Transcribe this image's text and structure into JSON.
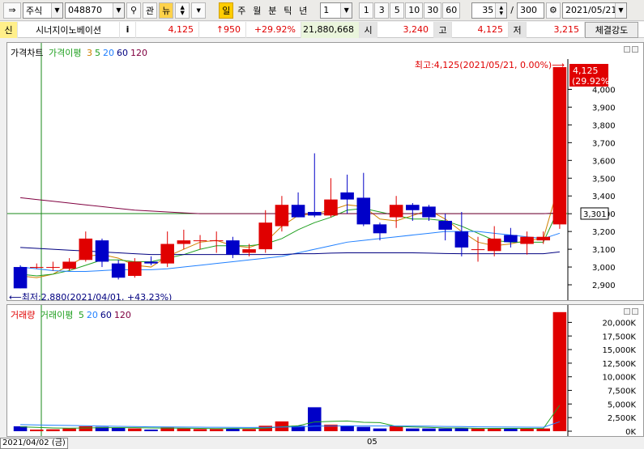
{
  "toolbar": {
    "market_select": "주식",
    "stock_code": "048870",
    "btn_gwan": "관",
    "btn_news": "뉴",
    "period_buttons": [
      "일",
      "주",
      "월",
      "분",
      "틱",
      "년"
    ],
    "unit_select": "1",
    "minute_buttons": [
      "1",
      "3",
      "5",
      "10",
      "30",
      "60"
    ],
    "display_count": "35",
    "slash": "/",
    "total_count": "300",
    "date": "2021/05/21"
  },
  "info": {
    "credit_badge": "신",
    "stock_name": "시너지이노베이션",
    "info_icon": "i",
    "price": "4,125",
    "change": "↑950",
    "change_rate": "+29.92%",
    "volume": "21,880,668",
    "open_label": "시",
    "open": "3,240",
    "high_label": "고",
    "high": "4,125",
    "low_label": "저",
    "low": "3,215",
    "strength_button": "체결강도"
  },
  "price_panel": {
    "legend_title": "가격차트",
    "legend_ma_label": "가격이평",
    "legend_ma_periods": [
      "3",
      "5",
      "20",
      "60",
      "120"
    ],
    "max_annotation": "최고:4,125(2021/05/21, 0.00%)⟶",
    "min_annotation": "⟵최저:2,880(2021/04/01, +43.23%)",
    "current_price_tag": "4,125",
    "current_rate_tag": "(29.92%)",
    "cursor_price_tag": "3,301",
    "y_ticks": [
      "4,000",
      "3,900",
      "3,800",
      "3,700",
      "3,600",
      "3,500",
      "3,400",
      "3,300",
      "3,200",
      "3,100",
      "3,000",
      "2,900"
    ]
  },
  "volume_panel": {
    "legend_title": "거래량",
    "legend_ma_label": "거래이평",
    "legend_ma_periods": [
      "5",
      "20",
      "60",
      "120"
    ],
    "y_ticks": [
      "20,000K",
      "17,500K",
      "15,000K",
      "12,500K",
      "10,000K",
      "7,500K",
      "5,000K",
      "2,500K",
      "0K"
    ]
  },
  "x_axis": {
    "cursor_date": "2021/04/02 (금)",
    "month_label": "05"
  },
  "colors": {
    "up": "#e00000",
    "down": "#0000c8",
    "ma3": "#d08000",
    "ma5": "#20a020",
    "ma20": "#2080ff",
    "ma60": "#000080",
    "ma120": "#800040",
    "crosshair": "#1a8a1a"
  },
  "chart_data": {
    "type": "candlestick",
    "ylim": [
      2850,
      4125
    ],
    "candles": [
      {
        "o": 3000,
        "c": 2880,
        "h": 3010,
        "l": 2880
      },
      {
        "o": 3000,
        "c": 3000,
        "h": 3020,
        "l": 2990
      },
      {
        "o": 3000,
        "c": 3000,
        "h": 3030,
        "l": 2980
      },
      {
        "o": 2990,
        "c": 3030,
        "h": 3050,
        "l": 2980
      },
      {
        "o": 3040,
        "c": 3160,
        "h": 3200,
        "l": 3030
      },
      {
        "o": 3150,
        "c": 3030,
        "h": 3160,
        "l": 3000
      },
      {
        "o": 3020,
        "c": 2940,
        "h": 3040,
        "l": 2930
      },
      {
        "o": 2950,
        "c": 3030,
        "h": 3050,
        "l": 2940
      },
      {
        "o": 3030,
        "c": 3020,
        "h": 3060,
        "l": 3010
      },
      {
        "o": 3020,
        "c": 3130,
        "h": 3200,
        "l": 3000
      },
      {
        "o": 3130,
        "c": 3150,
        "h": 3210,
        "l": 3100
      },
      {
        "o": 3150,
        "c": 3150,
        "h": 3180,
        "l": 3100
      },
      {
        "o": 3150,
        "c": 3150,
        "h": 3200,
        "l": 3080
      },
      {
        "o": 3150,
        "c": 3070,
        "h": 3170,
        "l": 3050
      },
      {
        "o": 3080,
        "c": 3100,
        "h": 3130,
        "l": 3060
      },
      {
        "o": 3100,
        "c": 3250,
        "h": 3320,
        "l": 3080
      },
      {
        "o": 3230,
        "c": 3350,
        "h": 3400,
        "l": 3200
      },
      {
        "o": 3350,
        "c": 3280,
        "h": 3420,
        "l": 3280
      },
      {
        "o": 3310,
        "c": 3290,
        "h": 3640,
        "l": 3280
      },
      {
        "o": 3290,
        "c": 3380,
        "h": 3500,
        "l": 3280
      },
      {
        "o": 3420,
        "c": 3380,
        "h": 3520,
        "l": 3300
      },
      {
        "o": 3390,
        "c": 3240,
        "h": 3530,
        "l": 3230
      },
      {
        "o": 3240,
        "c": 3190,
        "h": 3250,
        "l": 3150
      },
      {
        "o": 3280,
        "c": 3350,
        "h": 3400,
        "l": 3220
      },
      {
        "o": 3350,
        "c": 3320,
        "h": 3360,
        "l": 3260
      },
      {
        "o": 3340,
        "c": 3280,
        "h": 3350,
        "l": 3260
      },
      {
        "o": 3260,
        "c": 3210,
        "h": 3300,
        "l": 3150
      },
      {
        "o": 3200,
        "c": 3110,
        "h": 3310,
        "l": 3060
      },
      {
        "o": 3100,
        "c": 3100,
        "h": 3170,
        "l": 3030
      },
      {
        "o": 3090,
        "c": 3160,
        "h": 3230,
        "l": 3060
      },
      {
        "o": 3180,
        "c": 3140,
        "h": 3220,
        "l": 3110
      },
      {
        "o": 3130,
        "c": 3170,
        "h": 3200,
        "l": 3070
      },
      {
        "o": 3150,
        "c": 3170,
        "h": 3200,
        "l": 3130
      },
      {
        "o": 3240,
        "c": 4125,
        "h": 4125,
        "l": 3215
      }
    ],
    "ma_series": [
      {
        "name": "3",
        "values": [
          2950,
          2940,
          2960,
          3010,
          3060,
          3070,
          3050,
          3010,
          3000,
          3060,
          3100,
          3140,
          3150,
          3120,
          3110,
          3140,
          3230,
          3290,
          3300,
          3320,
          3350,
          3340,
          3270,
          3260,
          3290,
          3320,
          3270,
          3200,
          3140,
          3120,
          3130,
          3150,
          3160,
          3480
        ]
      },
      {
        "name": "5",
        "values": [
          2960,
          2950,
          2960,
          2980,
          3010,
          3040,
          3040,
          3030,
          3030,
          3050,
          3070,
          3100,
          3120,
          3120,
          3120,
          3130,
          3160,
          3210,
          3250,
          3280,
          3320,
          3330,
          3310,
          3290,
          3270,
          3270,
          3260,
          3230,
          3190,
          3150,
          3140,
          3140,
          3140,
          3340
        ]
      },
      {
        "name": "20",
        "values": [
          3000,
          2990,
          2980,
          2975,
          2975,
          2980,
          2985,
          2985,
          2985,
          2990,
          3000,
          3010,
          3020,
          3030,
          3040,
          3050,
          3060,
          3080,
          3100,
          3120,
          3140,
          3150,
          3160,
          3170,
          3180,
          3190,
          3200,
          3200,
          3200,
          3190,
          3180,
          3170,
          3160,
          3190
        ]
      },
      {
        "name": "60",
        "values": [
          3110,
          3105,
          3100,
          3095,
          3090,
          3085,
          3080,
          3075,
          3070,
          3070,
          3070,
          3070,
          3070,
          3070,
          3070,
          3070,
          3070,
          3075,
          3075,
          3078,
          3080,
          3080,
          3080,
          3080,
          3080,
          3078,
          3076,
          3075,
          3075,
          3075,
          3075,
          3075,
          3075,
          3085
        ]
      },
      {
        "name": "120",
        "values": [
          3390,
          3380,
          3370,
          3360,
          3350,
          3340,
          3330,
          3320,
          3315,
          3310,
          3305,
          3300,
          3300,
          3300,
          3300,
          3300,
          3300,
          3300,
          3300,
          3300,
          3300,
          3300,
          3300,
          3300,
          3300,
          3300,
          3300,
          3300,
          3300,
          3300,
          3300,
          3300,
          3300,
          3305
        ]
      }
    ],
    "volume_ylim": [
      0,
      22000
    ],
    "volumes": [
      900,
      300,
      350,
      500,
      900,
      800,
      600,
      500,
      300,
      700,
      500,
      400,
      400,
      500,
      400,
      1000,
      1800,
      1000,
      4400,
      1200,
      1000,
      800,
      500,
      900,
      500,
      500,
      500,
      600,
      500,
      500,
      500,
      500,
      500,
      21880
    ],
    "volume_ma_series": [
      {
        "name": "5",
        "values": [
          800,
          700,
          600,
          550,
          600,
          650,
          650,
          650,
          600,
          580,
          560,
          520,
          480,
          500,
          480,
          560,
          820,
          1000,
          1700,
          1800,
          1880,
          1640,
          1580,
          900,
          780,
          700,
          600,
          600,
          520,
          520,
          520,
          520,
          500,
          4760
        ]
      },
      {
        "name": "20",
        "values": [
          1200,
          1150,
          1100,
          1050,
          1000,
          950,
          900,
          850,
          800,
          780,
          760,
          740,
          720,
          700,
          680,
          700,
          760,
          800,
          920,
          960,
          980,
          980,
          970,
          960,
          940,
          920,
          880,
          850,
          800,
          780,
          760,
          740,
          720,
          1740
        ]
      }
    ]
  }
}
